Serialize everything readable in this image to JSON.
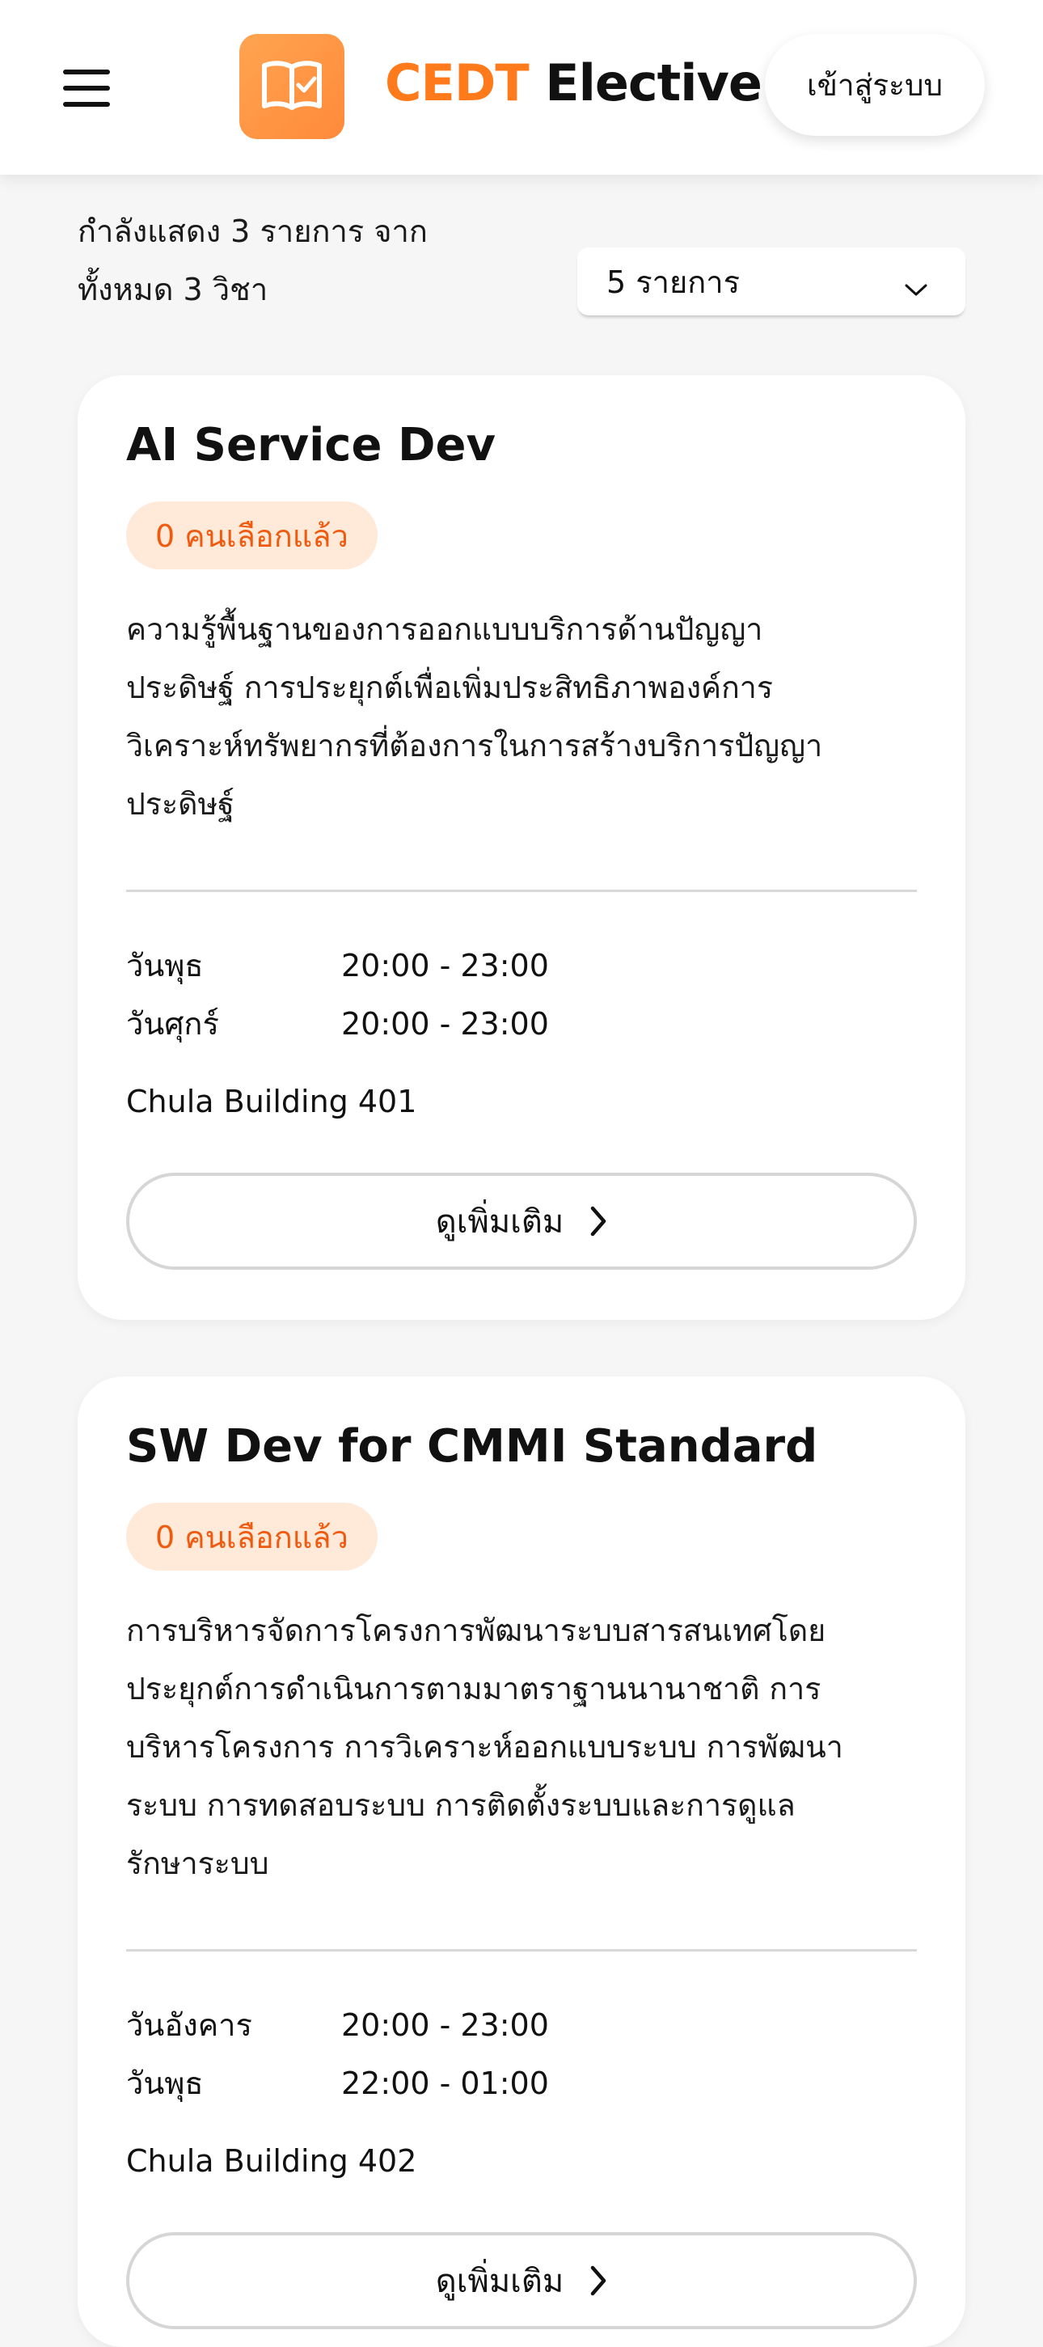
{
  "header": {
    "menu_icon": "hamburger-menu-icon",
    "logo_icon": "book-check-icon",
    "brand_accent": "CEDT",
    "brand_rest": " Elective",
    "login_label": "เข้าสู่ระบบ",
    "accent_color": "#ff7a1a"
  },
  "summary": {
    "line1": "กำลังแสดง 3 รายการ จาก",
    "line2": "ทั้งหมด 3 วิชา"
  },
  "page_size": {
    "value": "5 รายการ",
    "icon": "chevron-down-icon"
  },
  "courses": [
    {
      "title": "AI Service Dev",
      "badge": "0 คนเลือกแล้ว",
      "description_lines": [
        "ความรู้พื้นฐานของการออกแบบบริการด้านปัญญา",
        "ประดิษฐ์ การประยุกต์เพื่อเพิ่มประสิทธิภาพองค์การ",
        "วิเคราะห์ทรัพยากรที่ต้องการในการสร้างบริการปัญญา",
        "ประดิษฐ์"
      ],
      "schedule": [
        {
          "day": "วันพุธ",
          "time": "20:00 - 23:00"
        },
        {
          "day": "วันศุกร์",
          "time": "20:00 - 23:00"
        }
      ],
      "location": "Chula Building 401",
      "more_label": "ดูเพิ่มเติม"
    },
    {
      "title": "SW Dev for CMMI Standard",
      "badge": "0 คนเลือกแล้ว",
      "description_lines": [
        "การบริหารจัดการโครงการพัฒนาระบบสารสนเทศโดย",
        "ประยุกต์การดำเนินการตามมาตราฐานนานาชาติ การ",
        "บริหารโครงการ การวิเคราะห์ออกแบบระบบ การพัฒนา",
        "ระบบ การทดสอบระบบ การติดตั้งระบบและการดูแล",
        "รักษาระบบ"
      ],
      "schedule": [
        {
          "day": "วันอังคาร",
          "time": "20:00 - 23:00"
        },
        {
          "day": "วันพุธ",
          "time": "22:00 - 01:00"
        }
      ],
      "location": "Chula Building 402",
      "more_label": "ดูเพิ่มเติม"
    }
  ]
}
